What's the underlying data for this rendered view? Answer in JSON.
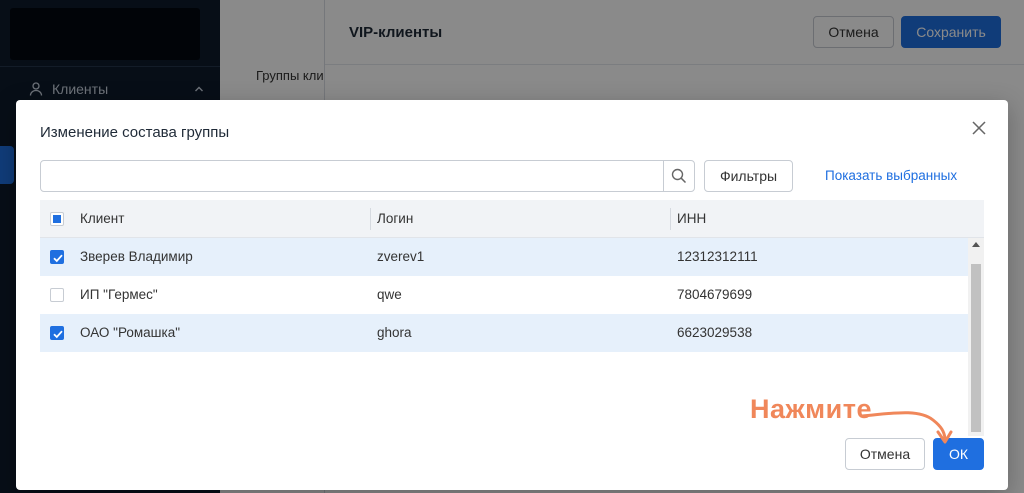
{
  "sidebar": {
    "nav_item_label": "Клиенты"
  },
  "background": {
    "tab_label": "Группы клиентов",
    "drawer_title": "VIP-клиенты",
    "cancel_label": "Отмена",
    "save_label": "Сохранить"
  },
  "modal": {
    "title": "Изменение состава группы",
    "search_value": "",
    "filters_label": "Фильтры",
    "show_selected_label": "Показать выбранных",
    "columns": [
      "Клиент",
      "Логин",
      "ИНН"
    ],
    "rows": [
      {
        "client": "Зверев Владимир",
        "login": "zverev1",
        "inn": "12312312111",
        "checked": true
      },
      {
        "client": "ИП \"Гермес\"",
        "login": "qwe",
        "inn": "7804679699",
        "checked": false
      },
      {
        "client": "ОАО \"Ромашка\"",
        "login": "ghora",
        "inn": "6623029538",
        "checked": true
      }
    ],
    "cancel_label": "Отмена",
    "ok_label": "ОК"
  },
  "hint": {
    "text": "Нажмите"
  },
  "colors": {
    "accent": "#1f6fe0",
    "hint": "#f0875a",
    "selected_row": "#e6f0fb"
  }
}
